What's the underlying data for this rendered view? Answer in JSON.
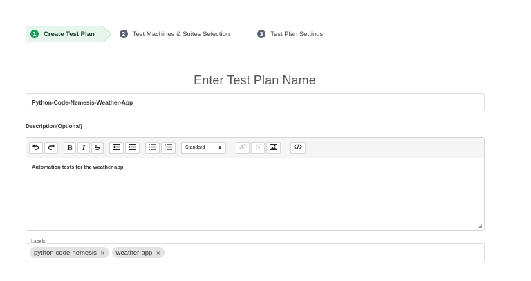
{
  "stepper": {
    "steps": [
      {
        "number": "1",
        "label": "Create Test Plan",
        "active": true
      },
      {
        "number": "2",
        "label": "Test Machines & Suites Selection",
        "active": false
      },
      {
        "number": "3",
        "label": "Test Plan Settings",
        "active": false
      }
    ],
    "active_color": "#1e9e5a",
    "inactive_color": "#5a6172"
  },
  "page_title": "Enter Test Plan Name",
  "name_input": {
    "value": "Python-Code-Nemesis-Weather-App"
  },
  "description": {
    "label": "Description(Optional)",
    "toolbar": {
      "undo_icon": "undo-icon",
      "redo_icon": "redo-icon",
      "bold": "B",
      "italic": "I",
      "strike": "S",
      "font_size_select": "Standard",
      "font_size_arrow": "⬍"
    },
    "content": "Automation tests for the weather app"
  },
  "labels": {
    "legend": "Labels",
    "chips": [
      {
        "text": "python-code-nemesis",
        "remove": "×"
      },
      {
        "text": "weather-app",
        "remove": "×"
      }
    ]
  }
}
